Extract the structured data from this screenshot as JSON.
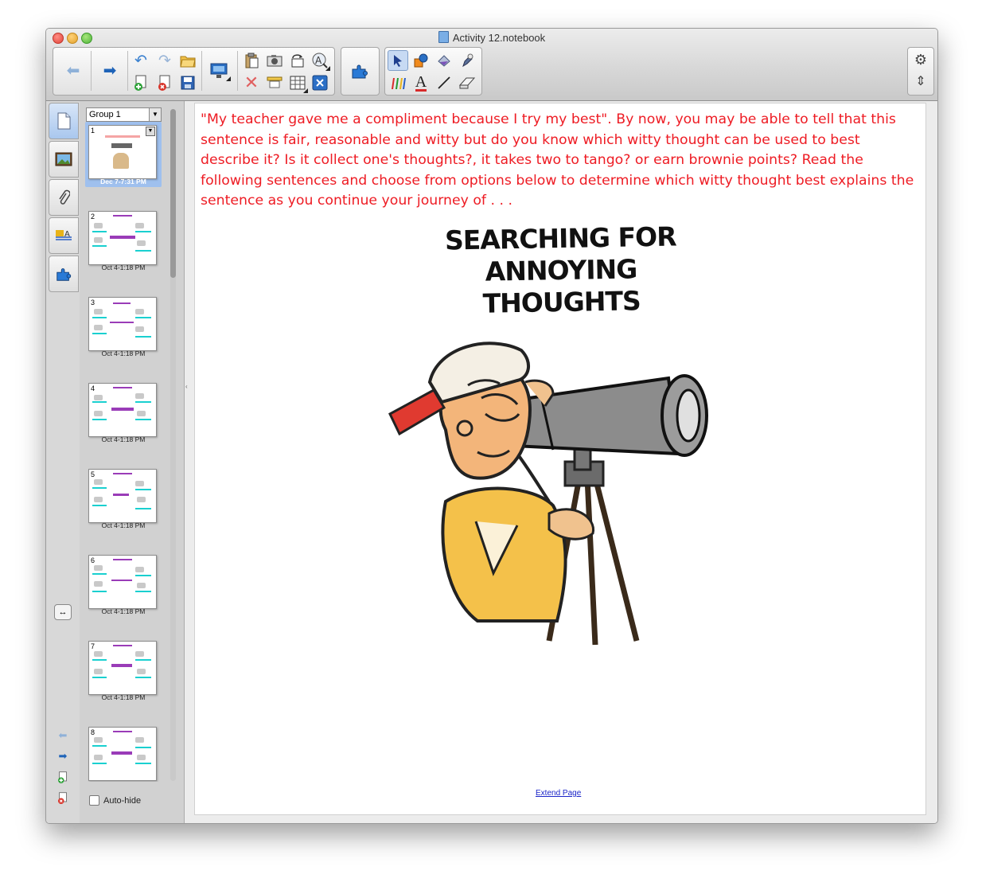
{
  "window": {
    "title": "Activity 12.notebook"
  },
  "toolbar": {
    "icons": [
      "back-arrow-icon",
      "forward-arrow-icon",
      "undo-icon",
      "redo-icon",
      "open-file-icon",
      "add-page-icon",
      "delete-page-icon",
      "save-icon",
      "screen-shade-icon",
      "paste-icon",
      "screen-capture-icon",
      "rotate-icon",
      "recognize-icon",
      "delete-icon",
      "fullscreen-icon",
      "table-icon",
      "clear-icon",
      "addons-icon",
      "select-icon",
      "shapes-icon",
      "fill-icon",
      "magic-pen-icon",
      "pens-icon",
      "text-icon",
      "line-icon",
      "eraser-icon",
      "settings-icon",
      "move-toolbar-icon"
    ]
  },
  "sidebar": {
    "tabs": [
      "page-sorter",
      "gallery",
      "attachments",
      "properties",
      "addons"
    ]
  },
  "sorter": {
    "group_label": "Group 1",
    "pages": [
      {
        "number": "1",
        "date": "Dec 7-7:31 PM"
      },
      {
        "number": "2",
        "date": "Oct 4-1:18 PM"
      },
      {
        "number": "3",
        "date": "Oct 4-1:18 PM"
      },
      {
        "number": "4",
        "date": "Oct 4-1:18 PM"
      },
      {
        "number": "5",
        "date": "Oct 4-1:18 PM"
      },
      {
        "number": "6",
        "date": "Oct 4-1:18 PM"
      },
      {
        "number": "7",
        "date": "Oct 4-1:18 PM"
      },
      {
        "number": "8",
        "date": ""
      }
    ],
    "autohide_label": "Auto-hide",
    "autohide_checked": false
  },
  "page": {
    "paragraph": "\"My teacher gave me a compliment because I try my best\".  By now, you may be able to tell that this sentence is fair,  reasonable and witty but do you know which witty thought can be used to best describe it?  Is it collect one's thoughts?, it takes two to tango? or earn brownie points?  Read the following sentences and choose from options below to determine which witty thought best explains the sentence as you continue your journey of . . .",
    "cartoon_title_line1": "SEARCHING FOR",
    "cartoon_title_line2": "ANNOYING THOUGHTS",
    "extend_link": "Extend Page",
    "text_color": "#ee1c24"
  }
}
